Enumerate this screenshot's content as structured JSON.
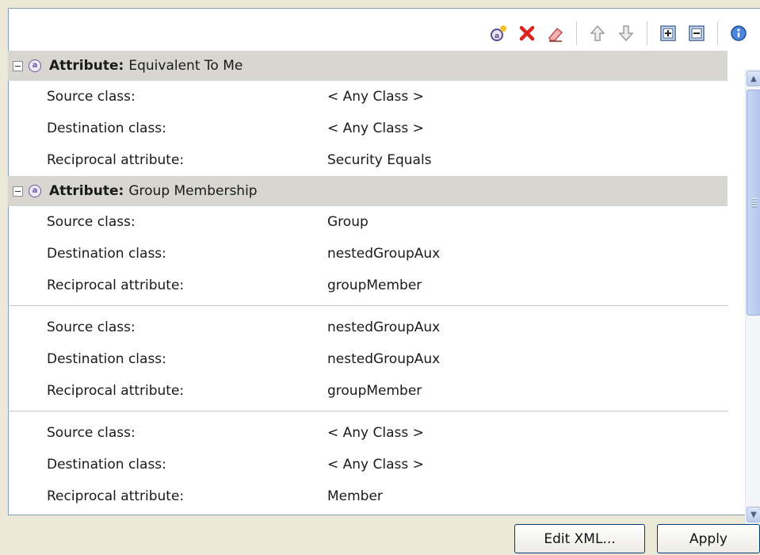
{
  "toolbar": {
    "buttons": [
      {
        "name": "new-attribute-icon"
      },
      {
        "name": "delete-icon"
      },
      {
        "name": "eraser-icon"
      },
      {
        "name": "move-up-icon"
      },
      {
        "name": "move-down-icon"
      },
      {
        "name": "expand-all-icon"
      },
      {
        "name": "collapse-all-icon"
      },
      {
        "name": "info-icon"
      }
    ],
    "colors": {
      "delete": "#d9261c",
      "info": "#2f6fd1"
    }
  },
  "groups": [
    {
      "key": "Attribute:",
      "name": "Equivalent To Me",
      "entries": [
        {
          "source_label": "Source class:",
          "source": "< Any Class >",
          "dest_label": "Destination class:",
          "dest": "< Any Class >",
          "recip_label": "Reciprocal attribute:",
          "recip": "Security Equals"
        }
      ]
    },
    {
      "key": "Attribute:",
      "name": "Group Membership",
      "entries": [
        {
          "source_label": "Source class:",
          "source": "Group",
          "dest_label": "Destination class:",
          "dest": "nestedGroupAux",
          "recip_label": "Reciprocal attribute:",
          "recip": "groupMember"
        },
        {
          "source_label": "Source class:",
          "source": "nestedGroupAux",
          "dest_label": "Destination class:",
          "dest": "nestedGroupAux",
          "recip_label": "Reciprocal attribute:",
          "recip": "groupMember"
        },
        {
          "source_label": "Source class:",
          "source": "< Any Class >",
          "dest_label": "Destination class:",
          "dest": "< Any Class >",
          "recip_label": "Reciprocal attribute:",
          "recip": "Member"
        }
      ]
    }
  ],
  "buttons": {
    "edit_xml": "Edit XML...",
    "apply": "Apply"
  }
}
